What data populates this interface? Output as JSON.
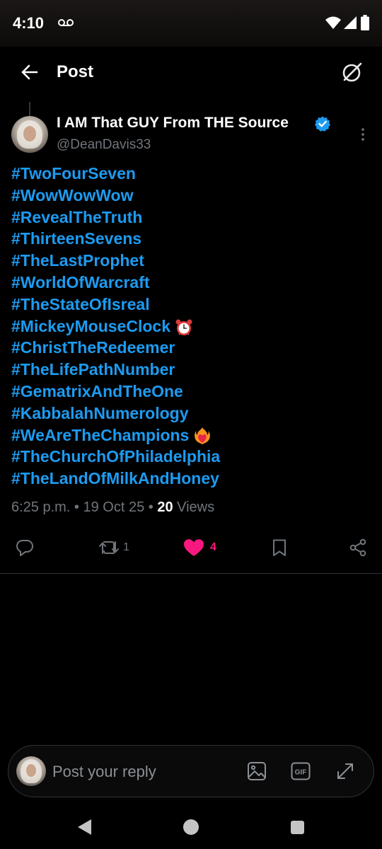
{
  "status_bar": {
    "time": "4:10",
    "icons": [
      "voicemail-icon",
      "wifi-icon",
      "cell-signal-icon",
      "battery-icon"
    ]
  },
  "header": {
    "title": "Post",
    "back_icon": "arrow-left-icon",
    "grok_icon": "grok-icon"
  },
  "post": {
    "author": {
      "name": "I AM That GUY From THE Source",
      "handle": "@DeanDavis33",
      "verified": true
    },
    "hashtags": [
      {
        "text": "#TwoFourSeven",
        "emoji": ""
      },
      {
        "text": "#WowWowWow",
        "emoji": ""
      },
      {
        "text": "#RevealTheTruth",
        "emoji": ""
      },
      {
        "text": "#ThirteenSevens",
        "emoji": ""
      },
      {
        "text": "#TheLastProphet",
        "emoji": ""
      },
      {
        "text": "#WorldOfWarcraft",
        "emoji": ""
      },
      {
        "text": "#TheStateOfIsreal",
        "emoji": ""
      },
      {
        "text": "#MickeyMouseClock",
        "emoji": "alarm-clock"
      },
      {
        "text": "#ChristTheRedeemer",
        "emoji": ""
      },
      {
        "text": "#TheLifePathNumber",
        "emoji": ""
      },
      {
        "text": "#GematrixAndTheOne",
        "emoji": ""
      },
      {
        "text": "#KabbalahNumerology",
        "emoji": ""
      },
      {
        "text": "#WeAreTheChampions",
        "emoji": "heart-on-fire"
      },
      {
        "text": "#TheChurchOfPhiladelphia",
        "emoji": ""
      },
      {
        "text": "#TheLandOfMilkAndHoney",
        "emoji": ""
      }
    ],
    "timestamp": "6:25 p.m. • 19 Oct 25 • ",
    "views_count": "20",
    "views_label": " Views",
    "actions": {
      "reply_count": "",
      "repost_count": "1",
      "like_count": "4",
      "liked": true
    }
  },
  "reply_bar": {
    "placeholder": "Post your reply",
    "gif_label": "GIF"
  },
  "colors": {
    "link": "#1d9bf0",
    "like": "#f91880",
    "muted": "#71767b",
    "background": "#000000"
  }
}
